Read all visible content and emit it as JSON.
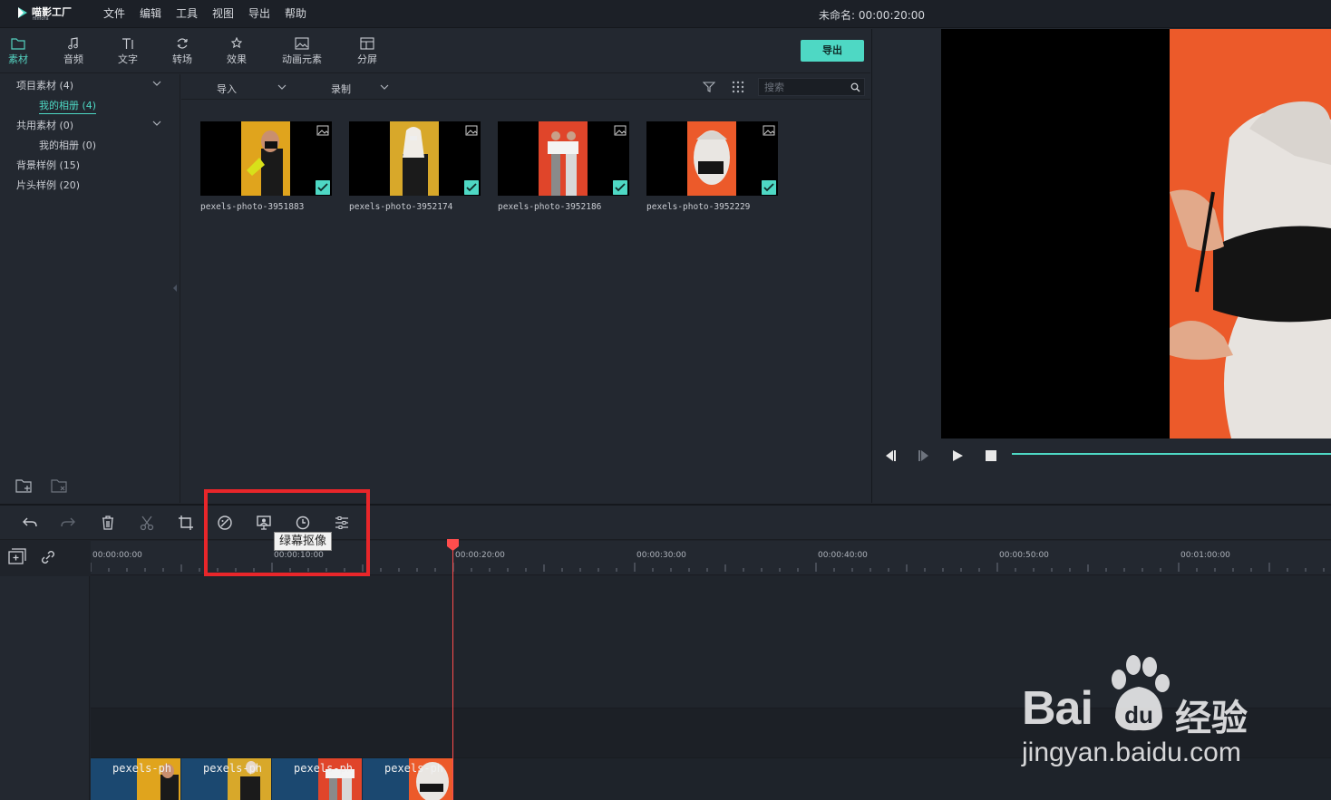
{
  "app": {
    "logo_name": "喵影工厂",
    "logo_sub": "filmora",
    "project_title": "未命名: 00:00:20:00"
  },
  "menu": [
    "文件",
    "编辑",
    "工具",
    "视图",
    "导出",
    "帮助"
  ],
  "library_tabs": [
    {
      "label": "素材",
      "icon": "folder-icon",
      "active": true
    },
    {
      "label": "音频",
      "icon": "music-note-icon",
      "active": false
    },
    {
      "label": "文字",
      "icon": "text-icon",
      "active": false
    },
    {
      "label": "转场",
      "icon": "transition-icon",
      "active": false
    },
    {
      "label": "效果",
      "icon": "effects-icon",
      "active": false
    },
    {
      "label": "动画元素",
      "icon": "elements-icon",
      "active": false
    },
    {
      "label": "分屏",
      "icon": "split-screen-icon",
      "active": false
    }
  ],
  "export_label": "导出",
  "tree": [
    {
      "label": "项目素材 (4)",
      "expandable": true
    },
    {
      "label": "我的相册 (4)",
      "selected": true
    },
    {
      "label": "共用素材 (0)",
      "expandable": true
    },
    {
      "label": "我的相册 (0)"
    },
    {
      "label": "背景样例 (15)"
    },
    {
      "label": "片头样例 (20)"
    }
  ],
  "media_toolbar": {
    "import_label": "导入",
    "record_label": "录制",
    "search_placeholder": "搜索"
  },
  "media": [
    {
      "name": "pexels-photo-3951883",
      "bg": "#e0a41d"
    },
    {
      "name": "pexels-photo-3952174",
      "bg": "#d8a82a"
    },
    {
      "name": "pexels-photo-3952186",
      "bg": "#e0452a"
    },
    {
      "name": "pexels-photo-3952229",
      "bg": "#ec5a2a"
    }
  ],
  "timeline": {
    "tooltip": "绿幕抠像",
    "ticks": [
      "00:00:00:00",
      "00:00:10:00",
      "00:00:20:00",
      "00:00:30:00",
      "00:00:40:00",
      "00:00:50:00",
      "00:01:00:00"
    ],
    "clips": [
      "pexels-ph",
      "pexels-ph",
      "pexels-ph",
      "pexels-ph"
    ]
  },
  "watermark": {
    "brand": "Bai",
    "suffix": "经验",
    "url": "jingyan.baidu.com"
  },
  "colors": {
    "accent": "#4ed8c4",
    "playhead": "#ff4d4d",
    "highlight": "#e8262a"
  }
}
